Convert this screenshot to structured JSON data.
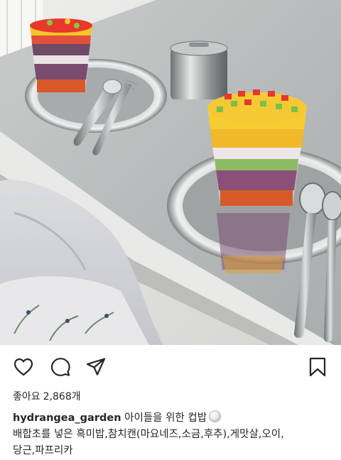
{
  "post": {
    "image_alt": "Layered rice cups on silver trays",
    "likes_label": "좋아요",
    "likes_count": "2,868개",
    "username": "hydrangea_garden",
    "caption_title": "아이들을 위한 컵밥",
    "caption_emoji": "rice-ball-emoji",
    "caption_line2": "배합초를 넣은 흑미밥,참치캔(마요네즈,소금,후추),게맛살,오이,",
    "caption_line3": "당근,파프리카"
  },
  "actions": {
    "like_icon": "heart-icon",
    "comment_icon": "comment-icon",
    "share_icon": "send-icon",
    "save_icon": "bookmark-icon"
  }
}
